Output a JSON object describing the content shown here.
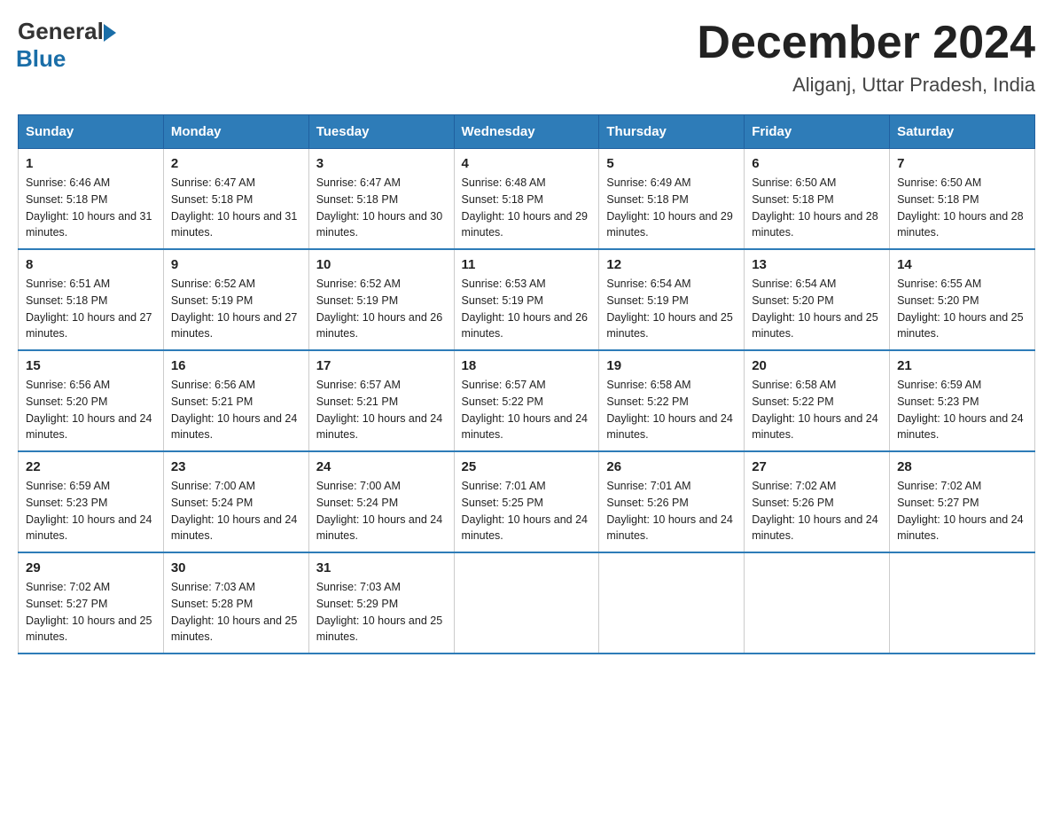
{
  "logo": {
    "general": "General",
    "arrow": "▶",
    "blue": "Blue"
  },
  "title": "December 2024",
  "location": "Aliganj, Uttar Pradesh, India",
  "header_days": [
    "Sunday",
    "Monday",
    "Tuesday",
    "Wednesday",
    "Thursday",
    "Friday",
    "Saturday"
  ],
  "weeks": [
    [
      {
        "day": "1",
        "sunrise": "6:46 AM",
        "sunset": "5:18 PM",
        "daylight": "10 hours and 31 minutes."
      },
      {
        "day": "2",
        "sunrise": "6:47 AM",
        "sunset": "5:18 PM",
        "daylight": "10 hours and 31 minutes."
      },
      {
        "day": "3",
        "sunrise": "6:47 AM",
        "sunset": "5:18 PM",
        "daylight": "10 hours and 30 minutes."
      },
      {
        "day": "4",
        "sunrise": "6:48 AM",
        "sunset": "5:18 PM",
        "daylight": "10 hours and 29 minutes."
      },
      {
        "day": "5",
        "sunrise": "6:49 AM",
        "sunset": "5:18 PM",
        "daylight": "10 hours and 29 minutes."
      },
      {
        "day": "6",
        "sunrise": "6:50 AM",
        "sunset": "5:18 PM",
        "daylight": "10 hours and 28 minutes."
      },
      {
        "day": "7",
        "sunrise": "6:50 AM",
        "sunset": "5:18 PM",
        "daylight": "10 hours and 28 minutes."
      }
    ],
    [
      {
        "day": "8",
        "sunrise": "6:51 AM",
        "sunset": "5:18 PM",
        "daylight": "10 hours and 27 minutes."
      },
      {
        "day": "9",
        "sunrise": "6:52 AM",
        "sunset": "5:19 PM",
        "daylight": "10 hours and 27 minutes."
      },
      {
        "day": "10",
        "sunrise": "6:52 AM",
        "sunset": "5:19 PM",
        "daylight": "10 hours and 26 minutes."
      },
      {
        "day": "11",
        "sunrise": "6:53 AM",
        "sunset": "5:19 PM",
        "daylight": "10 hours and 26 minutes."
      },
      {
        "day": "12",
        "sunrise": "6:54 AM",
        "sunset": "5:19 PM",
        "daylight": "10 hours and 25 minutes."
      },
      {
        "day": "13",
        "sunrise": "6:54 AM",
        "sunset": "5:20 PM",
        "daylight": "10 hours and 25 minutes."
      },
      {
        "day": "14",
        "sunrise": "6:55 AM",
        "sunset": "5:20 PM",
        "daylight": "10 hours and 25 minutes."
      }
    ],
    [
      {
        "day": "15",
        "sunrise": "6:56 AM",
        "sunset": "5:20 PM",
        "daylight": "10 hours and 24 minutes."
      },
      {
        "day": "16",
        "sunrise": "6:56 AM",
        "sunset": "5:21 PM",
        "daylight": "10 hours and 24 minutes."
      },
      {
        "day": "17",
        "sunrise": "6:57 AM",
        "sunset": "5:21 PM",
        "daylight": "10 hours and 24 minutes."
      },
      {
        "day": "18",
        "sunrise": "6:57 AM",
        "sunset": "5:22 PM",
        "daylight": "10 hours and 24 minutes."
      },
      {
        "day": "19",
        "sunrise": "6:58 AM",
        "sunset": "5:22 PM",
        "daylight": "10 hours and 24 minutes."
      },
      {
        "day": "20",
        "sunrise": "6:58 AM",
        "sunset": "5:22 PM",
        "daylight": "10 hours and 24 minutes."
      },
      {
        "day": "21",
        "sunrise": "6:59 AM",
        "sunset": "5:23 PM",
        "daylight": "10 hours and 24 minutes."
      }
    ],
    [
      {
        "day": "22",
        "sunrise": "6:59 AM",
        "sunset": "5:23 PM",
        "daylight": "10 hours and 24 minutes."
      },
      {
        "day": "23",
        "sunrise": "7:00 AM",
        "sunset": "5:24 PM",
        "daylight": "10 hours and 24 minutes."
      },
      {
        "day": "24",
        "sunrise": "7:00 AM",
        "sunset": "5:24 PM",
        "daylight": "10 hours and 24 minutes."
      },
      {
        "day": "25",
        "sunrise": "7:01 AM",
        "sunset": "5:25 PM",
        "daylight": "10 hours and 24 minutes."
      },
      {
        "day": "26",
        "sunrise": "7:01 AM",
        "sunset": "5:26 PM",
        "daylight": "10 hours and 24 minutes."
      },
      {
        "day": "27",
        "sunrise": "7:02 AM",
        "sunset": "5:26 PM",
        "daylight": "10 hours and 24 minutes."
      },
      {
        "day": "28",
        "sunrise": "7:02 AM",
        "sunset": "5:27 PM",
        "daylight": "10 hours and 24 minutes."
      }
    ],
    [
      {
        "day": "29",
        "sunrise": "7:02 AM",
        "sunset": "5:27 PM",
        "daylight": "10 hours and 25 minutes."
      },
      {
        "day": "30",
        "sunrise": "7:03 AM",
        "sunset": "5:28 PM",
        "daylight": "10 hours and 25 minutes."
      },
      {
        "day": "31",
        "sunrise": "7:03 AM",
        "sunset": "5:29 PM",
        "daylight": "10 hours and 25 minutes."
      },
      null,
      null,
      null,
      null
    ]
  ],
  "labels": {
    "sunrise_prefix": "Sunrise: ",
    "sunset_prefix": "Sunset: ",
    "daylight_prefix": "Daylight: "
  }
}
